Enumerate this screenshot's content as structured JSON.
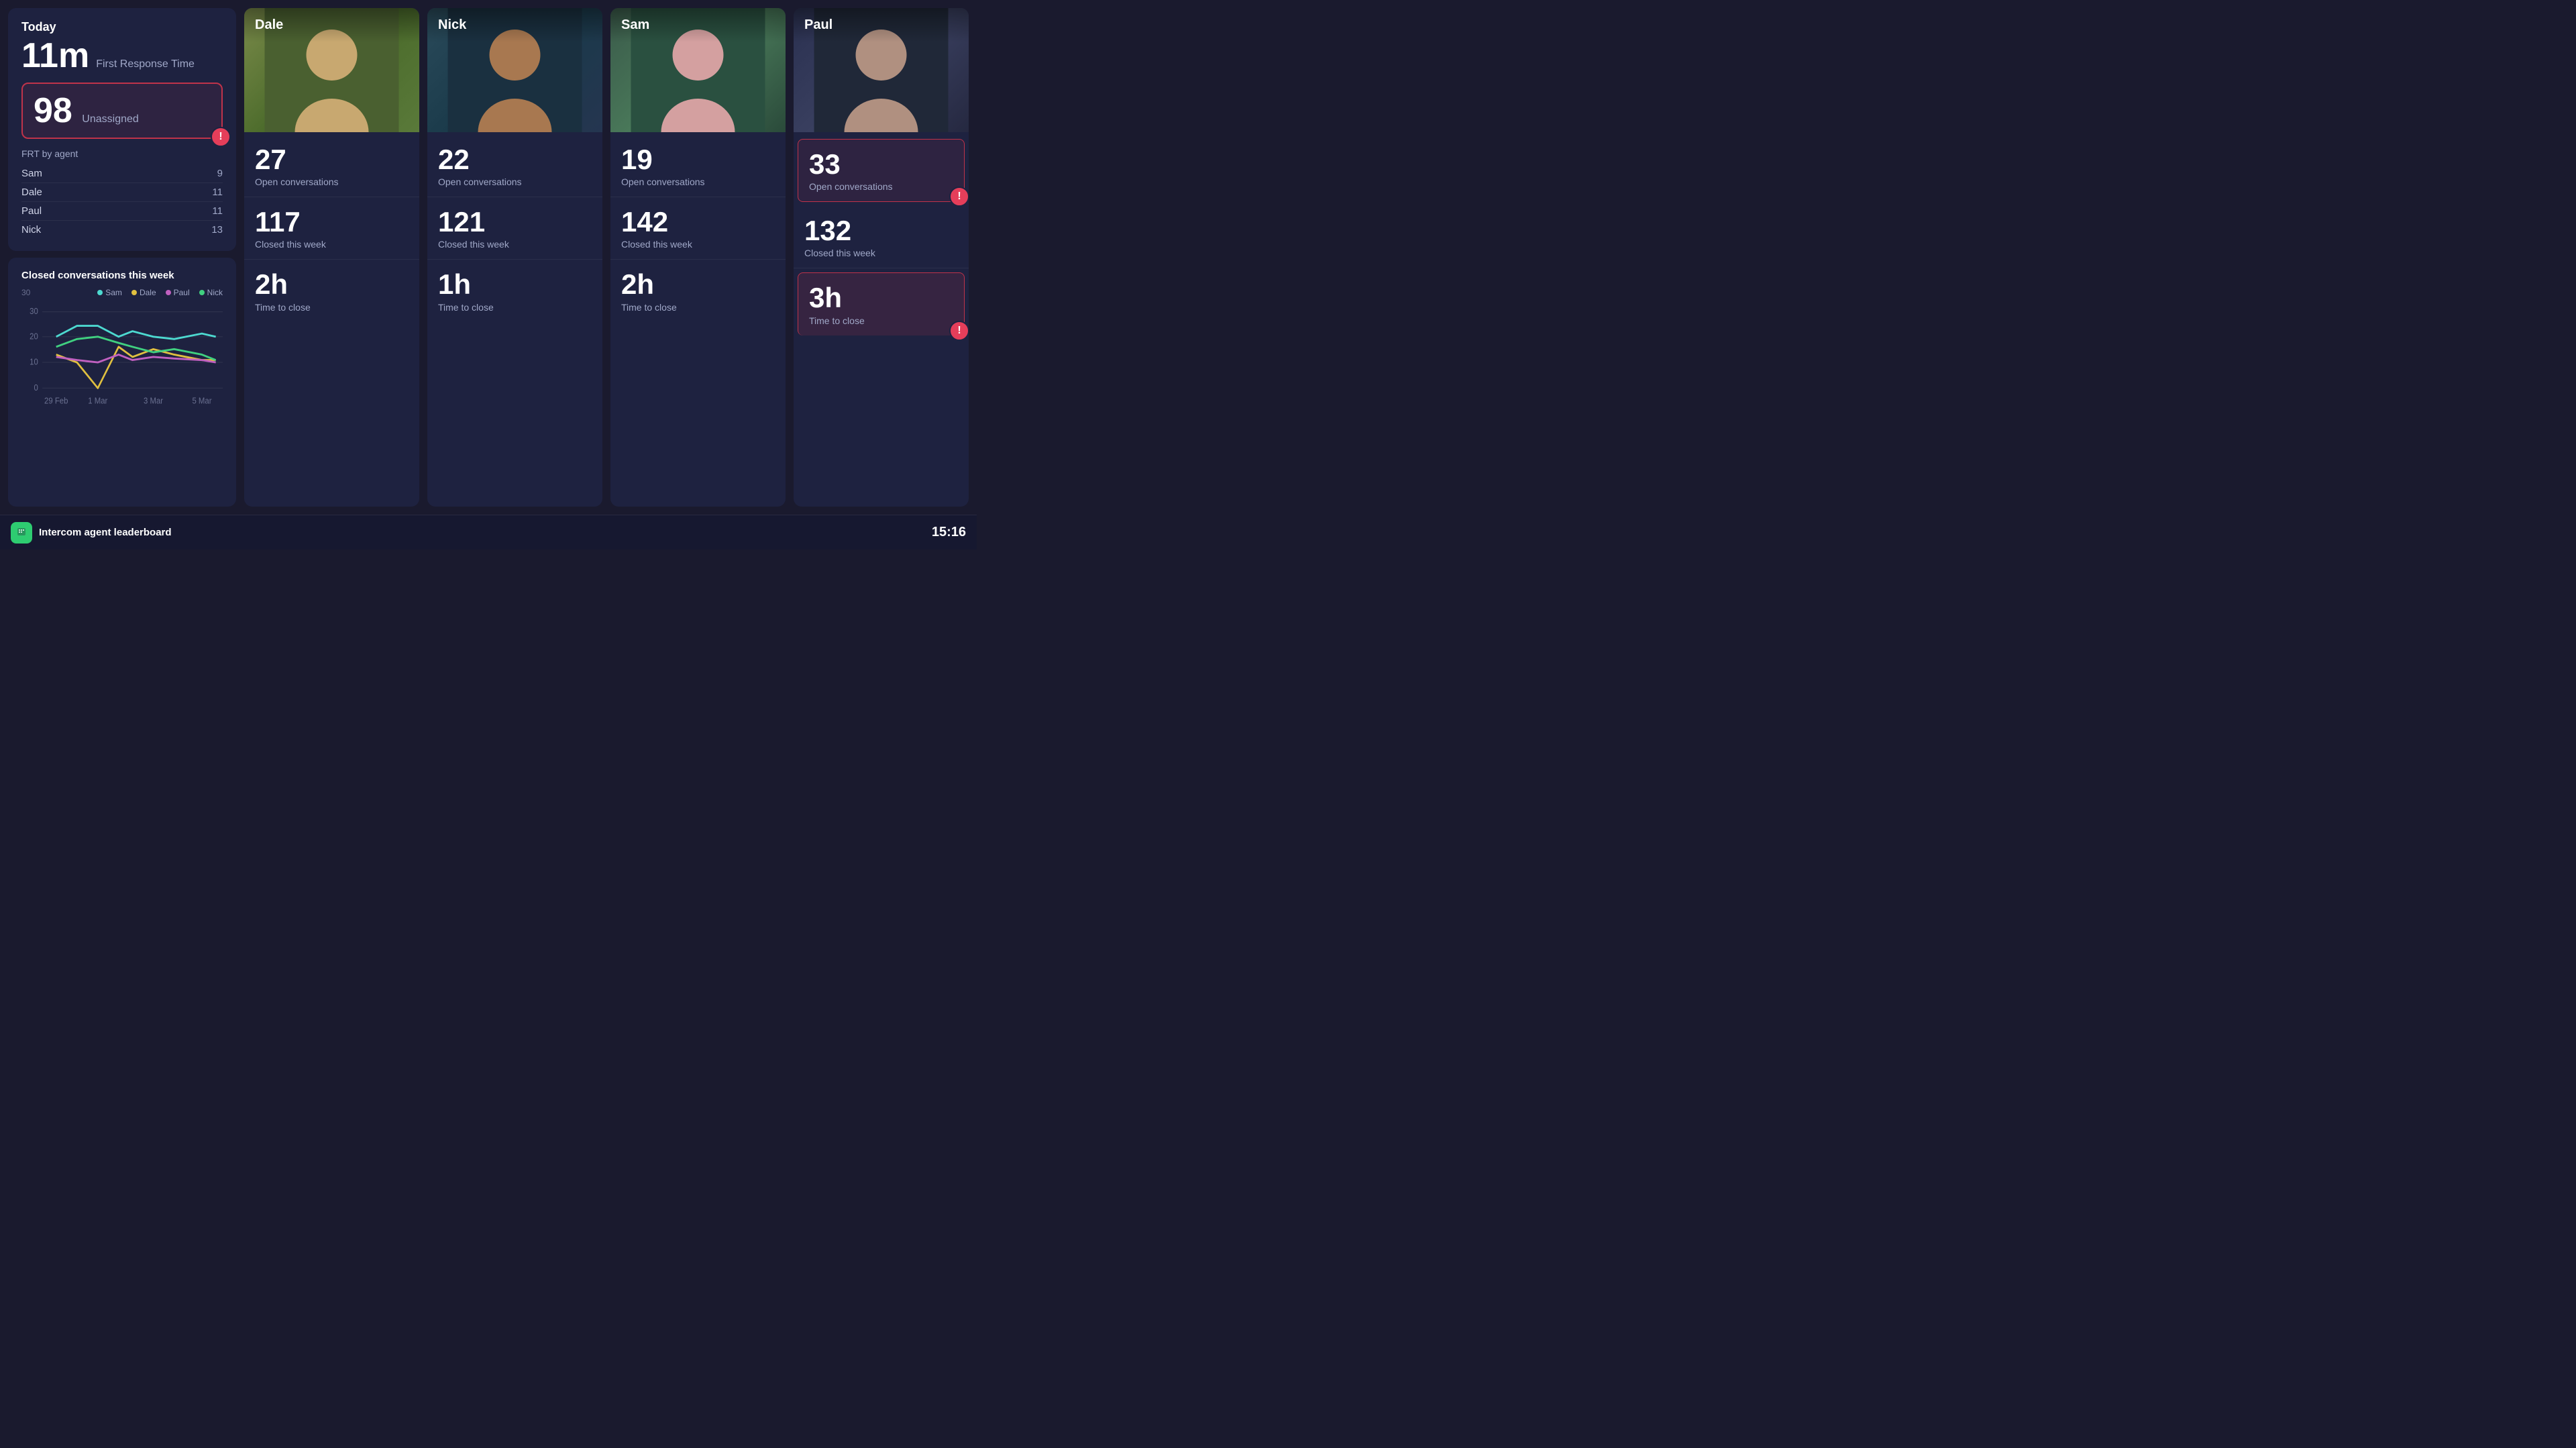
{
  "today": {
    "title": "Today",
    "frt": {
      "value": "11m",
      "label": "First Response Time"
    },
    "unassigned": {
      "number": "98",
      "label": "Unassigned"
    },
    "frt_by_agent": {
      "title": "FRT by agent",
      "agents": [
        {
          "name": "Sam",
          "value": "9"
        },
        {
          "name": "Dale",
          "value": "11"
        },
        {
          "name": "Paul",
          "value": "11"
        },
        {
          "name": "Nick",
          "value": "13"
        }
      ]
    }
  },
  "chart": {
    "title": "Closed conversations this week",
    "y_max": "30",
    "y_mid": "20",
    "y_low": "10",
    "y_min": "0",
    "x_labels": [
      "29 Feb",
      "1 Mar",
      "3 Mar",
      "5 Mar"
    ],
    "legend": [
      {
        "name": "Sam",
        "color": "#4dd9d0"
      },
      {
        "name": "Dale",
        "color": "#e0c040"
      },
      {
        "name": "Paul",
        "color": "#c060c0"
      },
      {
        "name": "Nick",
        "color": "#40d080"
      }
    ]
  },
  "agents": [
    {
      "name": "Dale",
      "photo_class": "dale-photo",
      "open_conversations": "27",
      "open_conversations_label": "Open conversations",
      "closed_this_week": "117",
      "closed_this_week_label": "Closed this week",
      "time_to_close": "2h",
      "time_to_close_label": "Time to close",
      "highlighted": false
    },
    {
      "name": "Nick",
      "photo_class": "nick-photo",
      "open_conversations": "22",
      "open_conversations_label": "Open conversations",
      "closed_this_week": "121",
      "closed_this_week_label": "Closed this week",
      "time_to_close": "1h",
      "time_to_close_label": "Time to close",
      "highlighted": false
    },
    {
      "name": "Sam",
      "photo_class": "sam-photo",
      "open_conversations": "19",
      "open_conversations_label": "Open conversations",
      "closed_this_week": "142",
      "closed_this_week_label": "Closed this week",
      "time_to_close": "2h",
      "time_to_close_label": "Time to close",
      "highlighted": false
    },
    {
      "name": "Paul",
      "photo_class": "paul-photo",
      "open_conversations": "33",
      "open_conversations_label": "Open conversations",
      "closed_this_week": "132",
      "closed_this_week_label": "Closed this week",
      "time_to_close": "3h",
      "time_to_close_label": "Time to close",
      "highlighted": true
    }
  ],
  "bottom_bar": {
    "title": "Intercom agent leaderboard",
    "time": "15:16"
  },
  "alert_label": "!"
}
